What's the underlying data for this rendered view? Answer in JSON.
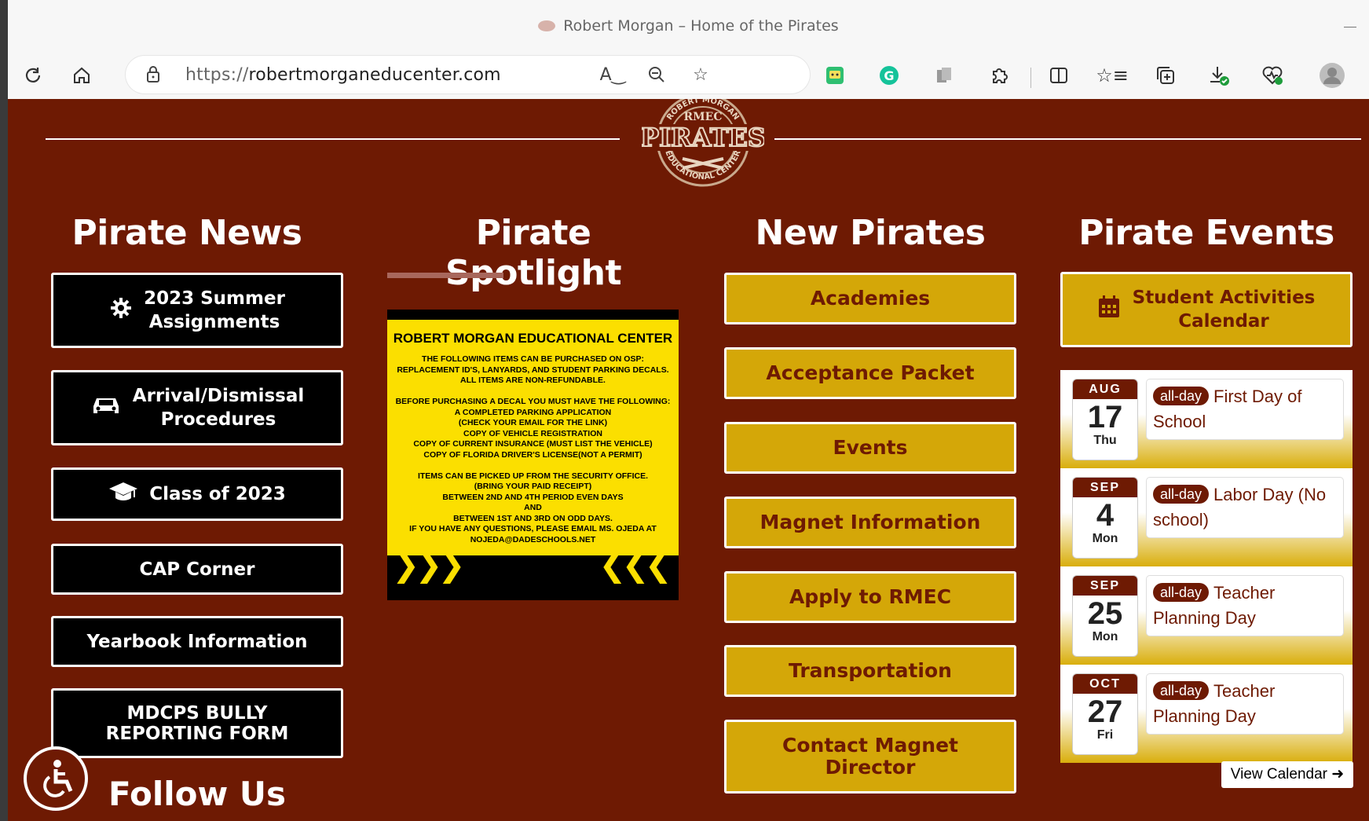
{
  "browser": {
    "window_title": "Robert Morgan – Home of the Pirates",
    "url_proto": "https://",
    "url_host": "robertmorganeducenter.com"
  },
  "icons": {
    "reload": "reload-icon",
    "home": "home-icon",
    "lock": "lock-icon",
    "read_aloud": "read-aloud-icon",
    "zoom": "zoom-out-icon",
    "favorite": "star-icon",
    "extensions": "puzzle-icon",
    "split": "split-screen-icon",
    "favorites": "favorites-icon",
    "collections": "collections-icon",
    "downloads": "download-icon",
    "health": "browser-essentials-icon",
    "profile": "profile-icon"
  },
  "colors": {
    "maroon": "#6e1a03",
    "gold": "#d4a708",
    "flyer_yellow": "#fbdf00"
  },
  "logo": {
    "top_text": "ROBERT MORGAN",
    "center": "RMEC",
    "main": "PIRATES",
    "bottom_text": "EDUCATIONAL CENTER"
  },
  "columns": {
    "news_title": "Pirate News",
    "spotlight_title": "Pirate Spotlight",
    "new_title": "New Pirates",
    "events_title": "Pirate Events"
  },
  "news": [
    {
      "label": "2023 Summer\nAssignments",
      "icon": "gear-icon"
    },
    {
      "label": "Arrival/Dismissal\nProcedures",
      "icon": "car-icon"
    },
    {
      "label": "Class of 2023",
      "icon": "graduation-cap-icon"
    },
    {
      "label": "CAP Corner"
    },
    {
      "label": "Yearbook Information"
    },
    {
      "label": "MDCPS BULLY\nREPORTING FORM"
    }
  ],
  "flyer": {
    "heading": "ROBERT MORGAN EDUCATIONAL CENTER",
    "body": "THE FOLLOWING ITEMS CAN BE PURCHASED ON OSP:\nREPLACEMENT ID'S, LANYARDS, AND STUDENT PARKING DECALS.\nALL ITEMS ARE NON-REFUNDABLE.\n\nBEFORE PURCHASING A DECAL YOU MUST HAVE THE FOLLOWING:\nA COMPLETED PARKING APPLICATION\n(CHECK YOUR EMAIL FOR THE LINK)\nCOPY OF VEHICLE REGISTRATION\nCOPY OF CURRENT INSURANCE (MUST LIST THE VEHICLE)\nCOPY OF FLORIDA DRIVER'S LICENSE(NOT A PERMIT)\n\nITEMS CAN BE PICKED UP FROM THE SECURITY OFFICE.\n(BRING YOUR PAID RECEIPT)\nBETWEEN 2ND AND 4TH PERIOD EVEN DAYS\nAND\nBETWEEN 1ST AND 3RD ON ODD DAYS.\nIF YOU HAVE ANY QUESTIONS, PLEASE EMAIL MS. OJEDA AT\nNOJEDA@DADESCHOOLS.NET"
  },
  "new_pirates": [
    "Academies",
    "Acceptance Packet",
    "Events",
    "Magnet Information",
    "Apply to RMEC",
    "Transportation",
    "Contact Magnet\nDirector"
  ],
  "calendar_button": "Student Activities\nCalendar",
  "events": [
    {
      "mon": "AUG",
      "day": "17",
      "dow": "Thu",
      "badge": "all-day",
      "title": "First Day of School"
    },
    {
      "mon": "SEP",
      "day": "4",
      "dow": "Mon",
      "badge": "all-day",
      "title": "Labor Day (No school)"
    },
    {
      "mon": "SEP",
      "day": "25",
      "dow": "Mon",
      "badge": "all-day",
      "title": "Teacher Planning Day"
    },
    {
      "mon": "OCT",
      "day": "27",
      "dow": "Fri",
      "badge": "all-day",
      "title": "Teacher Planning Day"
    }
  ],
  "view_calendar": "View Calendar",
  "follow_us": "Follow Us"
}
